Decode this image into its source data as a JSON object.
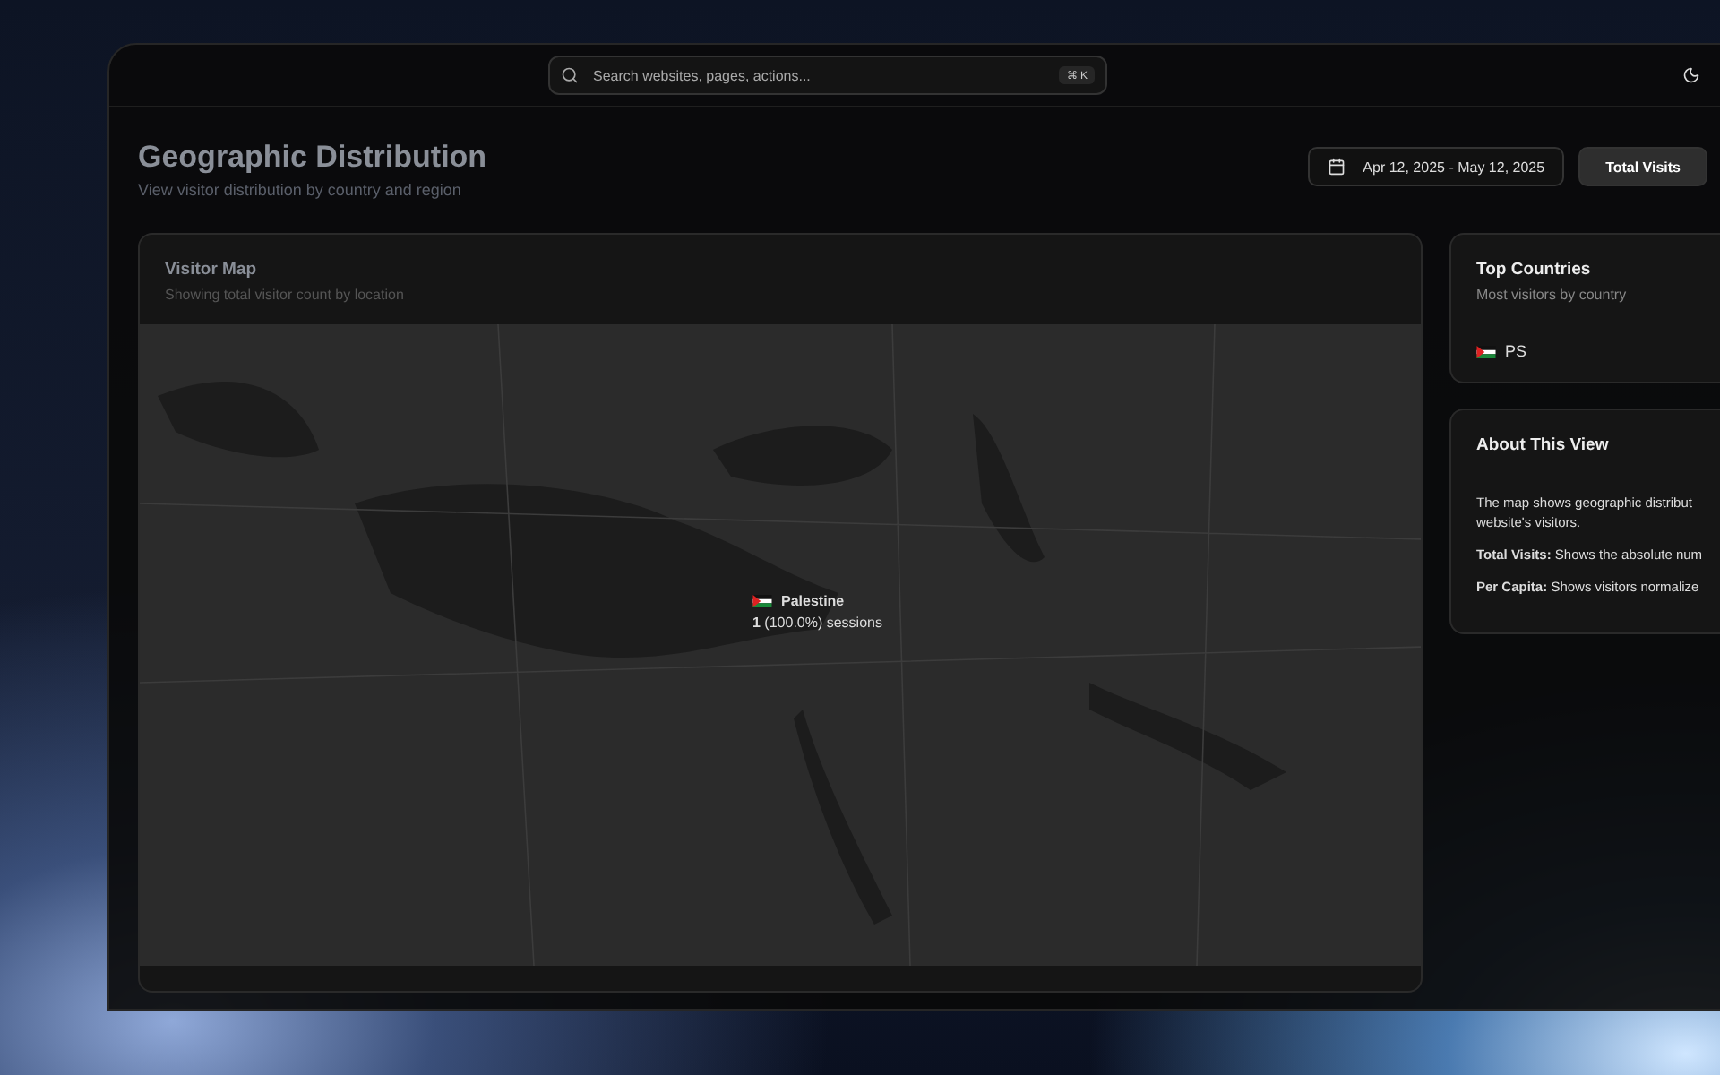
{
  "search": {
    "placeholder": "Search websites, pages, actions...",
    "shortcut": "⌘ K"
  },
  "header": {
    "title": "Geographic Distribution",
    "subtitle": "View visitor distribution by country and region"
  },
  "date_range": "Apr 12, 2025 - May 12, 2025",
  "view_toggle": [
    {
      "label": "Total Visits",
      "selected": true
    }
  ],
  "map_card": {
    "title": "Visitor Map",
    "subtitle": "Showing total visitor count by location",
    "tooltip": {
      "country": "Palestine",
      "text": "**1** (100.0%) sessions"
    }
  },
  "top_countries": {
    "title": "Top Countries",
    "subtitle": "Most visitors by country",
    "items": [
      {
        "code": "PS"
      }
    ]
  },
  "about": {
    "title": "About This View",
    "paragraphs": [
      "The map shows geographic distribut website's visitors.",
      "**Total Visits:** Shows the absolute num",
      "**Per Capita:** Shows visitors normalize"
    ]
  }
}
